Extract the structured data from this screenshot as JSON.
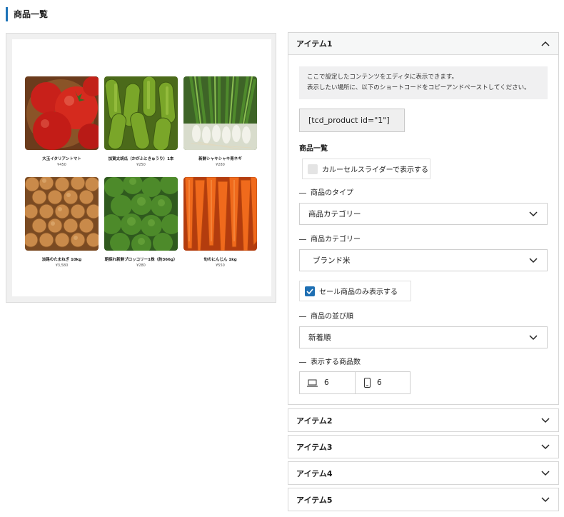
{
  "page": {
    "title": "商品一覧"
  },
  "preview": {
    "products": [
      {
        "name": "大玉イタリアントマト",
        "price": "¥450",
        "image": "tomatoes"
      },
      {
        "name": "加賀太胡瓜（かがふときゅうり）1本",
        "price": "¥250",
        "image": "cucumbers"
      },
      {
        "name": "新鮮シャキシャキ青ネギ",
        "price": "¥280",
        "image": "green-onions"
      },
      {
        "name": "淡路のたまねぎ 10kg",
        "price": "¥3,580",
        "image": "onions"
      },
      {
        "name": "朝採れ新鮮ブロッコリー1株（約366g）",
        "price": "¥280",
        "image": "broccoli"
      },
      {
        "name": "旬のにんじん 1kg",
        "price": "¥550",
        "image": "carrots"
      }
    ]
  },
  "items": [
    {
      "label": "アイテム1",
      "open": true,
      "info_line1": "ここで設定したコンテンツをエディタに表示できます。",
      "info_line2": "表示したい場所に、以下のショートコードをコピーアンドペーストしてください。",
      "shortcode": "[tcd_product id=\"1\"]",
      "section_title": "商品一覧",
      "carousel_label": "カルーセルスライダーで表示する",
      "carousel_checked": false,
      "type_label": "商品のタイプ",
      "type_value": "商品カテゴリー",
      "category_label": "商品カテゴリー",
      "category_value": "ブランド米",
      "sale_label": "セール商品のみ表示する",
      "sale_checked": true,
      "order_label": "商品の並び順",
      "order_value": "新着順",
      "count_label": "表示する商品数",
      "count_pc": "6",
      "count_sp": "6"
    },
    {
      "label": "アイテム2",
      "open": false
    },
    {
      "label": "アイテム3",
      "open": false
    },
    {
      "label": "アイテム4",
      "open": false
    },
    {
      "label": "アイテム5",
      "open": false
    }
  ],
  "colors": {
    "accent": "#1e74b8",
    "checkbox": "#1e6fb3"
  }
}
